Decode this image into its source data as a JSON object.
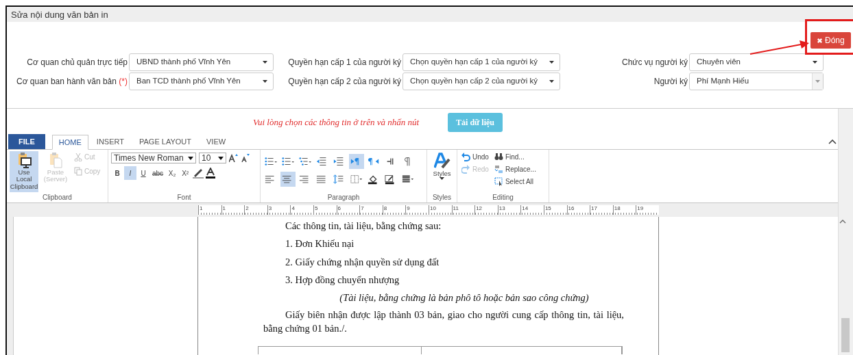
{
  "window": {
    "title": "Sửa nội dung văn bản in"
  },
  "close_button": {
    "label": "Đóng"
  },
  "form": {
    "fields": [
      {
        "label": "Cơ quan chủ quản trực tiếp",
        "value": "UBND thành phố Vĩnh Yên",
        "kind": "select"
      },
      {
        "label": "Quyền hạn cấp 1 của người ký",
        "value": "Chọn quyền hạn cấp 1 của người ký",
        "kind": "select"
      },
      {
        "label": "Chức vụ người ký",
        "value": "Chuyên viên",
        "kind": "select"
      },
      {
        "label": "Cơ quan ban hành văn bản",
        "required_mark": "(*)",
        "value": "Ban TCD thành phố Vĩnh Yên",
        "kind": "select"
      },
      {
        "label": "Quyền hạn cấp 2 của người ký",
        "value": "Chọn quyền hạn cấp 2 của người ký",
        "kind": "select"
      },
      {
        "label": "Người ký",
        "value": "Phí Mạnh Hiếu",
        "kind": "combo"
      }
    ]
  },
  "load_prompt": {
    "message": "Vui lòng chọn các thông tin ở trên và nhấn nút",
    "button": "Tải dữ liệu"
  },
  "ribbon": {
    "tabs": [
      {
        "label": "FILE",
        "kind": "file",
        "selected": false
      },
      {
        "label": "HOME",
        "kind": "tab",
        "selected": true
      },
      {
        "label": "INSERT",
        "kind": "tab",
        "selected": false
      },
      {
        "label": "PAGE LAYOUT",
        "kind": "tab",
        "selected": false
      },
      {
        "label": "VIEW",
        "kind": "tab",
        "selected": false
      }
    ],
    "clipboard": {
      "title": "Clipboard",
      "large": [
        {
          "label": "Use Local Clipboard",
          "kind": "monitor",
          "active": true,
          "disabled": false
        },
        {
          "label": "Paste (Server)",
          "kind": "paste",
          "active": false,
          "disabled": true
        }
      ],
      "small": [
        {
          "label": "Cut",
          "kind": "cut",
          "disabled": true
        },
        {
          "label": "Copy",
          "kind": "copy",
          "disabled": true
        }
      ]
    },
    "font": {
      "title": "Font",
      "font_name": "Times New Roman",
      "font_size": "10",
      "buttons": [
        {
          "text": "B",
          "kind": "bold",
          "active": false
        },
        {
          "text": "I",
          "kind": "italic",
          "active": true
        },
        {
          "text": "U",
          "kind": "underline",
          "active": false
        },
        {
          "text": "abc",
          "kind": "strike",
          "active": false
        },
        {
          "text": "X₂",
          "kind": "sub",
          "active": false
        },
        {
          "text": "X²",
          "kind": "sup",
          "active": false
        }
      ]
    },
    "paragraph": {
      "title": "Paragraph",
      "row1": [
        {
          "kind": "bullets",
          "active": false
        },
        {
          "kind": "numbering",
          "active": false
        },
        {
          "kind": "multilevel",
          "active": false
        },
        {
          "kind": "outdent",
          "active": false
        },
        {
          "kind": "indent",
          "active": false
        },
        {
          "kind": "ltr",
          "active": true
        },
        {
          "kind": "rtl",
          "active": false
        },
        {
          "kind": "pilcrow-bar",
          "active": false
        },
        {
          "kind": "pilcrow",
          "active": false
        }
      ],
      "row2": [
        {
          "kind": "align-left",
          "active": false
        },
        {
          "kind": "align-center",
          "active": true
        },
        {
          "kind": "align-right",
          "active": false
        },
        {
          "kind": "justify",
          "active": false
        },
        {
          "kind": "spacing",
          "active": false
        },
        {
          "kind": "borders",
          "active": false
        },
        {
          "kind": "shading",
          "active": false
        },
        {
          "kind": "highlight",
          "active": false
        },
        {
          "kind": "lines",
          "active": false
        }
      ]
    },
    "styles": {
      "title": "Styles",
      "label": "Styles"
    },
    "editing": {
      "title": "Editing",
      "items": [
        {
          "label": "Undo",
          "kind": "undo",
          "disabled": false
        },
        {
          "label": "Find...",
          "kind": "find",
          "disabled": false
        },
        {
          "label": "Redo",
          "kind": "redo",
          "disabled": true
        },
        {
          "label": "Replace...",
          "kind": "replace",
          "disabled": false
        },
        {
          "label": "Select All",
          "kind": "select-all",
          "disabled": false
        }
      ]
    }
  },
  "ruler": {
    "labels": [
      "1",
      "1",
      "2",
      "3",
      "4",
      "5",
      "6",
      "7",
      "8",
      "9",
      "10",
      "11",
      "12",
      "13",
      "14",
      "15",
      "16",
      "17",
      "18",
      "19"
    ]
  },
  "document": {
    "paragraphs": [
      {
        "text": "Các thông tin, tài liệu, bằng chứng sau:",
        "kind": "indent"
      },
      {
        "text": "1. Đơn Khiếu nại",
        "kind": "indent"
      },
      {
        "text": "2. Giấy chứng nhận quyền sử dụng đất",
        "kind": "indent"
      },
      {
        "text": "3. Hợp đồng chuyển nhượng",
        "kind": "indent"
      },
      {
        "text": "(Tài liệu, bằng chứng là bản phô tô hoặc bản sao công chứng)",
        "kind": "note"
      },
      {
        "text": "Giấy biên nhận được lập thành 03 bản, giao cho người cung cấp thông tin, tài liệu, bằng chứng 01 bản./.",
        "kind": "body"
      }
    ]
  }
}
